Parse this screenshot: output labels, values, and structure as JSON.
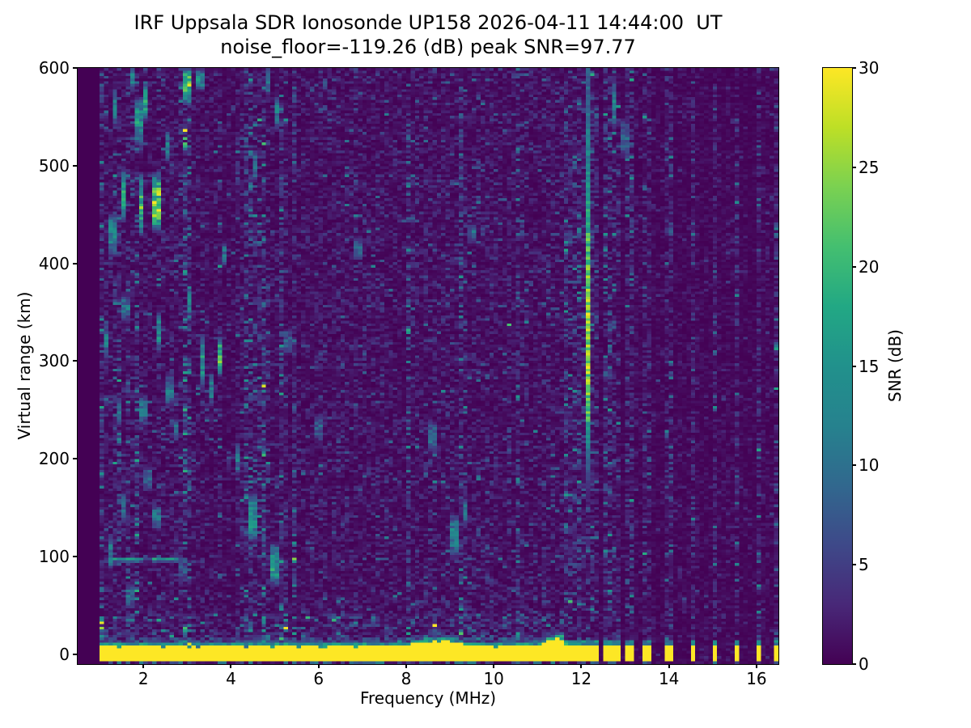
{
  "chart_data": {
    "type": "heatmap",
    "title": "IRF Uppsala SDR Ionosonde UP158 2026-04-11 14:44:00  UT",
    "subtitle": "noise_floor=-119.26 (dB) peak SNR=97.77",
    "xlabel": "Frequency (MHz)",
    "ylabel": "Virtual range (km)",
    "x_range": [
      0.5,
      16.5
    ],
    "y_range": [
      -10,
      600
    ],
    "x_ticks": [
      2,
      4,
      6,
      8,
      10,
      12,
      14,
      16
    ],
    "y_ticks": [
      0,
      100,
      200,
      300,
      400,
      500,
      600
    ],
    "colorbar": {
      "label": "SNR (dB)",
      "ticks": [
        0,
        5,
        10,
        15,
        20,
        25,
        30
      ],
      "vmin": 0,
      "vmax": 30,
      "colormap": "viridis"
    },
    "colormap_stops": [
      "#440154",
      "#482878",
      "#3e4989",
      "#31688e",
      "#26828e",
      "#21918c",
      "#22a884",
      "#44bf70",
      "#7ad151",
      "#bddf26",
      "#fde725"
    ],
    "grid": {
      "cols": 160,
      "rows": 224
    },
    "noise": {
      "seed": 1337,
      "no_data_below_mhz": 1.0,
      "region_gains": [
        [
          3.6,
          2.6
        ],
        [
          5.5,
          1.9
        ],
        [
          11.62,
          1.5
        ],
        [
          16.5,
          0.75
        ]
      ],
      "low_altitude_boost": {
        "f_max": 11.62,
        "r_min": 10,
        "r_max": 42,
        "gain": 1.7
      },
      "mid_gain_columns": [
        4.55,
        8.05,
        9.3,
        10.55
      ],
      "mid_column_gain": 1.8,
      "active_column_gain": 3.2,
      "streaky_below_mhz": 5.5
    },
    "features": {
      "ground_band": {
        "f": [
          1.0,
          11.62
        ],
        "r_top": 8.2,
        "r_bottom": -6.5,
        "snr": 60,
        "fringe_bumps": [
          {
            "f": 8.7,
            "sigma": 0.7,
            "amp": 5
          },
          {
            "f": 11.45,
            "sigma": 0.28,
            "amp": 8
          }
        ]
      },
      "e_layer": {
        "f": [
          1.18,
          2.78
        ],
        "r": 97,
        "snr": 15,
        "gap_f": [
          2.02,
          2.2
        ]
      },
      "rfi_streak": {
        "f": 12.15,
        "half_width": 0.045,
        "r": [
          145,
          600
        ],
        "r_peak": 330,
        "sigma": 170,
        "snr_peak": 25,
        "snr_base": 6,
        "fade_below": 250
      },
      "tx_bars": [
        11.63,
        11.76,
        11.9,
        12.04,
        12.2,
        12.38,
        12.54,
        12.7,
        12.86,
        13.02,
        13.17,
        13.5,
        14.0,
        14.55,
        15.08,
        15.55,
        16.08,
        16.42
      ],
      "bar_half_width_mhz": 0.055,
      "blobs": [
        [
          1.15,
          320,
          20,
          11
        ],
        [
          1.25,
          105,
          20,
          13
        ],
        [
          1.3,
          430,
          25,
          12
        ],
        [
          1.35,
          560,
          22,
          13
        ],
        [
          1.45,
          250,
          15,
          9
        ],
        [
          1.55,
          470,
          30,
          17
        ],
        [
          1.55,
          150,
          18,
          10
        ],
        [
          1.6,
          355,
          15,
          10
        ],
        [
          1.7,
          60,
          15,
          9
        ],
        [
          1.75,
          590,
          15,
          12
        ],
        [
          1.9,
          545,
          28,
          15
        ],
        [
          1.95,
          460,
          35,
          19
        ],
        [
          2.0,
          250,
          18,
          10
        ],
        [
          2.05,
          565,
          22,
          16
        ],
        [
          2.1,
          180,
          15,
          9
        ],
        [
          2.3,
          462,
          33,
          24
        ],
        [
          2.35,
          330,
          22,
          14
        ],
        [
          2.3,
          140,
          14,
          10
        ],
        [
          2.55,
          520,
          18,
          12
        ],
        [
          2.6,
          270,
          18,
          10
        ],
        [
          2.75,
          230,
          14,
          9
        ],
        [
          2.85,
          90,
          14,
          9
        ],
        [
          3.0,
          582,
          22,
          21
        ],
        [
          3.05,
          360,
          18,
          12
        ],
        [
          3.3,
          588,
          12,
          14
        ],
        [
          3.35,
          300,
          28,
          16
        ],
        [
          3.55,
          272,
          18,
          12
        ],
        [
          3.75,
          305,
          22,
          20
        ],
        [
          3.85,
          410,
          14,
          10
        ],
        [
          4.15,
          200,
          18,
          12
        ],
        [
          4.5,
          140,
          28,
          14
        ],
        [
          4.55,
          500,
          18,
          10
        ],
        [
          4.85,
          585,
          15,
          11
        ],
        [
          5.0,
          92,
          24,
          16
        ],
        [
          5.05,
          555,
          18,
          12
        ],
        [
          5.3,
          320,
          14,
          8
        ],
        [
          6.0,
          232,
          13,
          8
        ],
        [
          6.9,
          415,
          13,
          8
        ],
        [
          8.6,
          222,
          18,
          10
        ],
        [
          9.1,
          122,
          24,
          12
        ],
        [
          9.35,
          145,
          18,
          10
        ],
        [
          9.5,
          430,
          12,
          8
        ],
        [
          12.75,
          562,
          28,
          12
        ],
        [
          13.0,
          528,
          22,
          8
        ]
      ]
    }
  }
}
